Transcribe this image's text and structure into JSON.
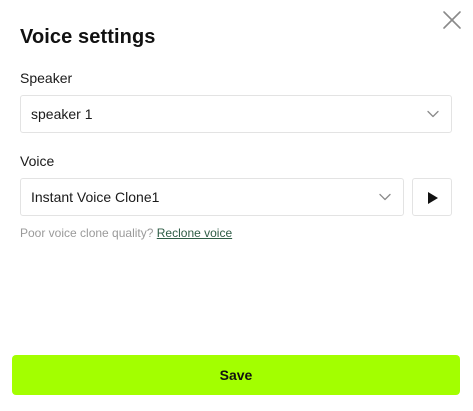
{
  "dialog": {
    "title": "Voice settings"
  },
  "speaker": {
    "label": "Speaker",
    "selected": "speaker 1"
  },
  "voice": {
    "label": "Voice",
    "selected": "Instant Voice Clone1"
  },
  "hint": {
    "text": "Poor voice clone quality?",
    "link": "Reclone voice"
  },
  "actions": {
    "save_label": "Save"
  },
  "icons": {
    "close": "close-icon",
    "chevron": "chevron-down-icon",
    "play": "play-icon"
  },
  "colors": {
    "accent": "#a3ff00",
    "link": "#2f5d46",
    "hint": "#9a9a9a",
    "border": "#e3e3e3"
  }
}
